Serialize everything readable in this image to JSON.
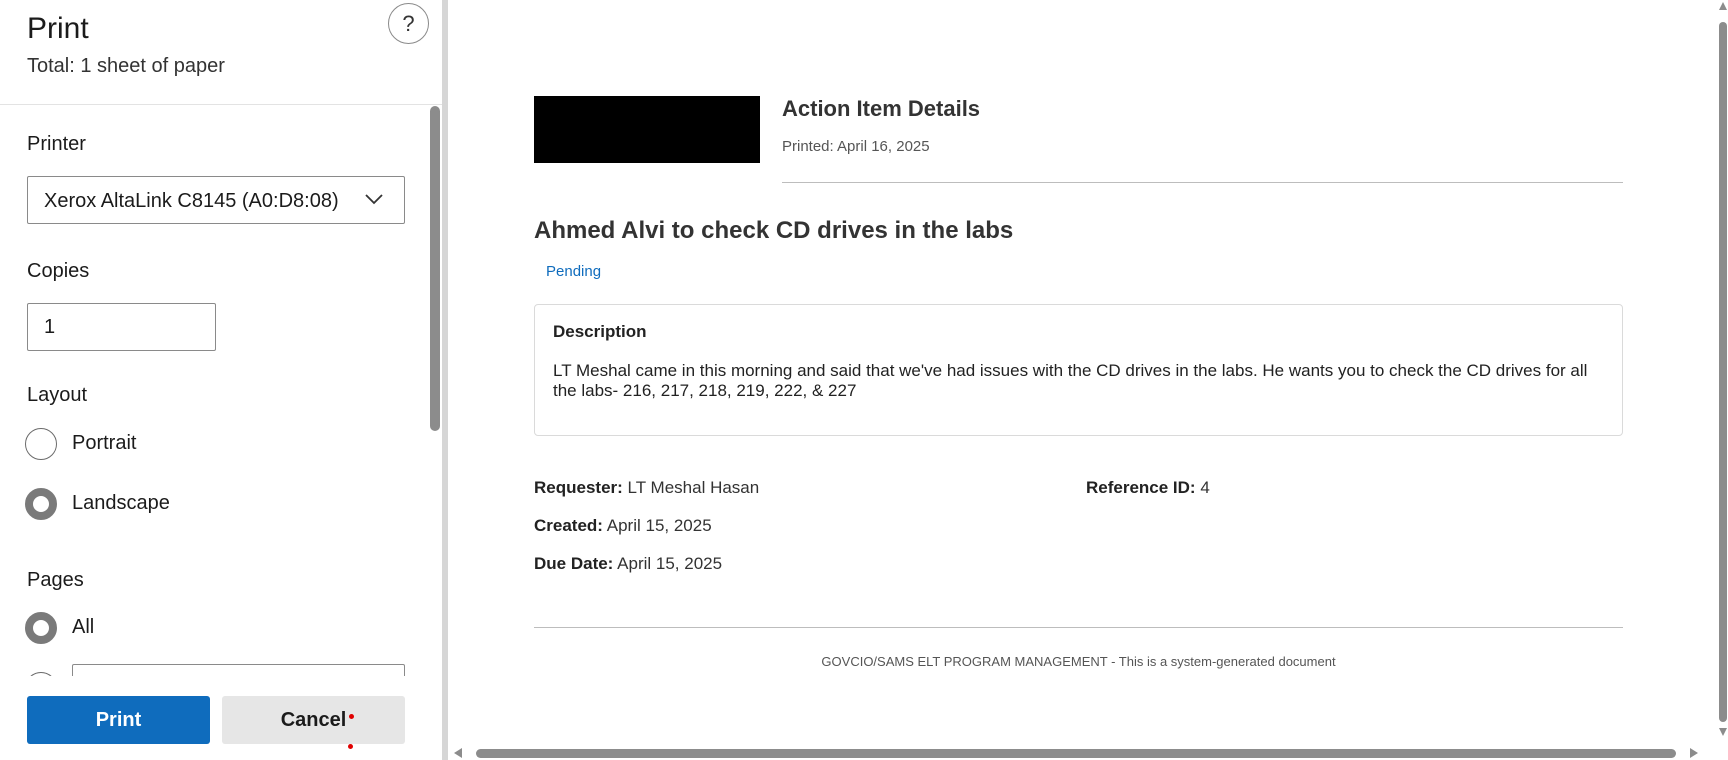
{
  "panel": {
    "title": "Print",
    "subtitle": "Total: 1 sheet of paper",
    "help_symbol": "?",
    "printer_label": "Printer",
    "printer_value": "Xerox AltaLink C8145 (A0:D8:08)",
    "copies_label": "Copies",
    "copies_value": "1",
    "layout_label": "Layout",
    "layout_options": [
      "Portrait",
      "Landscape"
    ],
    "layout_selected": "Landscape",
    "pages_label": "Pages",
    "pages_options": [
      "All"
    ],
    "pages_selected": "All",
    "print_button": "Print",
    "cancel_button": "Cancel"
  },
  "document": {
    "header_title": "Action Item Details",
    "printed": "Printed: April 16, 2025",
    "item_title": "Ahmed Alvi to check CD drives in the labs",
    "status": "Pending",
    "description_heading": "Description",
    "description_text": "LT Meshal came in this morning and said that we've had issues with the CD drives in the labs. He wants you to check the CD drives for all the labs- 216, 217, 218, 219, 222, & 227",
    "requester_label": "Requester:",
    "requester_value": "LT Meshal Hasan",
    "reference_label": "Reference ID:",
    "reference_value": "4",
    "created_label": "Created:",
    "created_value": "April 15, 2025",
    "due_label": "Due Date:",
    "due_value": "April 15, 2025",
    "footer": "GOVCIO/SAMS ELT PROGRAM MANAGEMENT - This is a system-generated document"
  },
  "colors": {
    "accent": "#0f6cbd",
    "status": "#0f6cbd",
    "logo_block": "#000000"
  },
  "icons": {
    "help": "help-icon",
    "dropdown": "chevron-down-icon"
  }
}
